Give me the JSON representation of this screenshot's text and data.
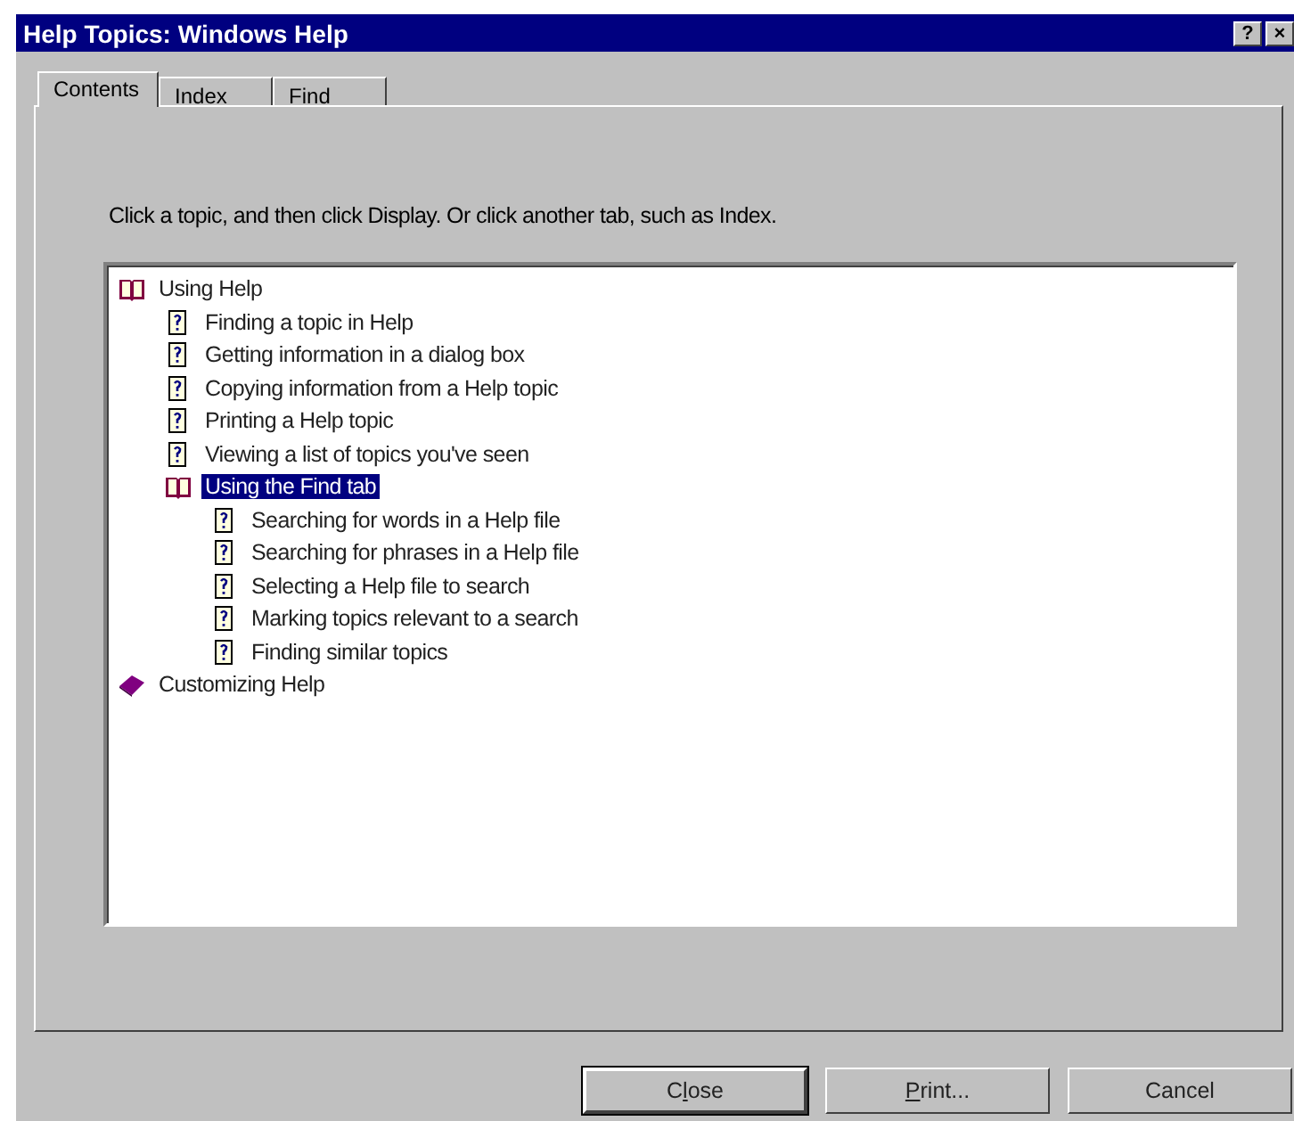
{
  "window": {
    "title": "Help Topics: Windows Help",
    "title_buttons": [
      "?",
      "×"
    ]
  },
  "tabs": [
    {
      "label": "Contents",
      "selected": true
    },
    {
      "label": "Index",
      "selected": false
    },
    {
      "label": "Find",
      "selected": false
    }
  ],
  "instruction": "Click a topic, and then click Display. Or click another tab, such as Index.",
  "tree": [
    {
      "kind": "book",
      "label": "Using Help",
      "expanded": true,
      "selected": false,
      "children": [
        {
          "kind": "topic",
          "label": "Finding a topic in Help",
          "selected": false
        },
        {
          "kind": "topic",
          "label": "Getting information in a dialog box",
          "selected": false
        },
        {
          "kind": "topic",
          "label": "Copying information from a Help topic",
          "selected": false
        },
        {
          "kind": "topic",
          "label": "Printing a Help topic",
          "selected": false
        },
        {
          "kind": "topic",
          "label": "Viewing a list of topics you've seen",
          "selected": false
        },
        {
          "kind": "book",
          "label": "Using the Find tab",
          "expanded": true,
          "selected": true,
          "children": [
            {
              "kind": "topic",
              "label": "Searching for words in a Help file",
              "selected": false
            },
            {
              "kind": "topic",
              "label": "Searching for phrases in a Help file",
              "selected": false
            },
            {
              "kind": "topic",
              "label": "Selecting a Help file to search",
              "selected": false
            },
            {
              "kind": "topic",
              "label": "Marking topics relevant to a search",
              "selected": false
            },
            {
              "kind": "topic",
              "label": "Finding similar topics",
              "selected": false
            }
          ]
        }
      ]
    },
    {
      "kind": "book",
      "label": "Customizing Help",
      "expanded": false,
      "selected": false
    }
  ],
  "buttons": [
    {
      "before": "C",
      "mnemonic": "l",
      "after": "ose",
      "default": true
    },
    {
      "mnemonic": "P",
      "after": "rint...",
      "default": false
    },
    {
      "before": "Cancel",
      "default": false
    }
  ]
}
